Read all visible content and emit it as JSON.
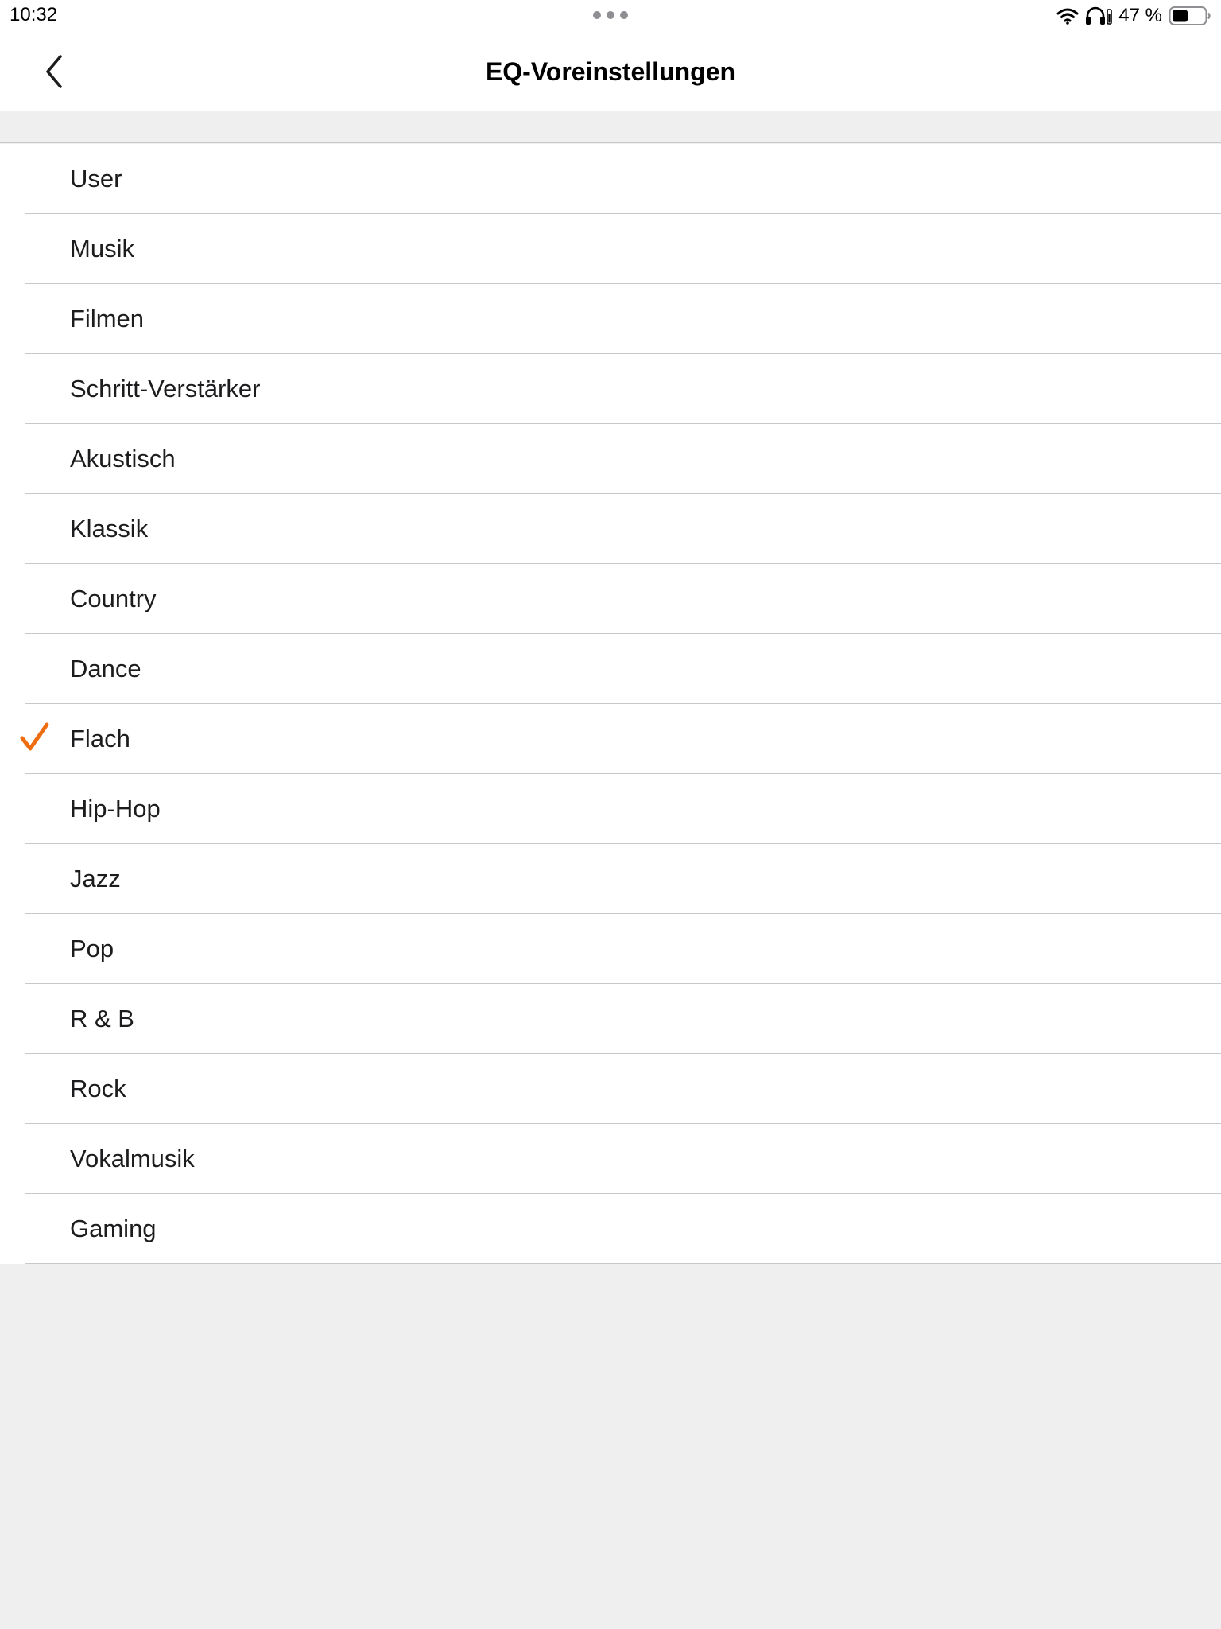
{
  "status_bar": {
    "time": "10:32",
    "battery_percent": "47 %",
    "icons": [
      "wifi-icon",
      "headphones-icon",
      "battery-icon"
    ]
  },
  "nav": {
    "title": "EQ-Voreinstellungen",
    "back_icon": "chevron-left-icon"
  },
  "presets": {
    "selected": "Flach",
    "accent_color": "#ee6d10",
    "items": [
      {
        "label": "User"
      },
      {
        "label": "Musik"
      },
      {
        "label": "Filmen"
      },
      {
        "label": "Schritt-Verstärker"
      },
      {
        "label": "Akustisch"
      },
      {
        "label": "Klassik"
      },
      {
        "label": "Country"
      },
      {
        "label": "Dance"
      },
      {
        "label": "Flach"
      },
      {
        "label": "Hip-Hop"
      },
      {
        "label": "Jazz"
      },
      {
        "label": "Pop"
      },
      {
        "label": "R & B"
      },
      {
        "label": "Rock"
      },
      {
        "label": "Vokalmusik"
      },
      {
        "label": "Gaming"
      }
    ]
  }
}
